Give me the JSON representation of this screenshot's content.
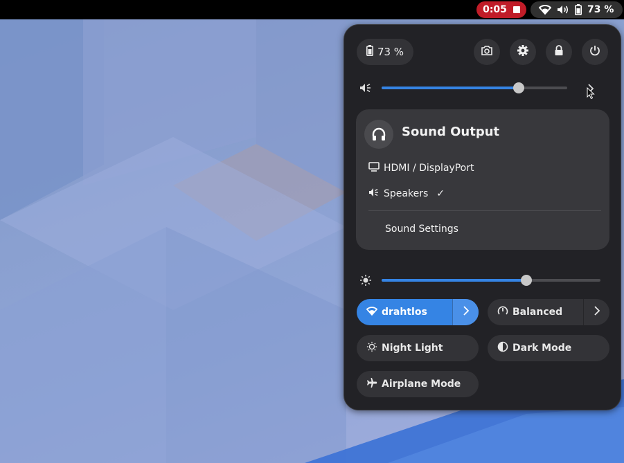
{
  "topbar": {
    "recording_time": "0:05",
    "battery_percent": "73 %",
    "icons": [
      "stop-icon",
      "wifi-icon",
      "volume-icon",
      "battery-icon"
    ]
  },
  "quick_settings": {
    "battery_label": "73 %",
    "system_buttons": [
      {
        "name": "screenshot-icon"
      },
      {
        "name": "gear-icon"
      },
      {
        "name": "lock-icon"
      },
      {
        "name": "power-icon"
      }
    ],
    "volume": {
      "icon": "speaker-icon",
      "level": 0.74
    },
    "sound_output": {
      "title": "Sound Output",
      "devices": [
        {
          "label": "HDMI / DisplayPort",
          "icon": "monitor-icon",
          "selected": false
        },
        {
          "label": "Speakers",
          "icon": "speaker-icon",
          "selected": true,
          "check": "✓"
        }
      ],
      "settings_label": "Sound Settings"
    },
    "brightness": {
      "icon": "brightness-icon",
      "level": 0.66
    },
    "toggles": {
      "wifi": {
        "label": "drahtlos",
        "active": true
      },
      "power_mode": {
        "label": "Balanced",
        "active": false
      },
      "night_light": {
        "label": "Night Light",
        "active": false
      },
      "dark_mode": {
        "label": "Dark Mode",
        "active": false
      },
      "airplane": {
        "label": "Airplane Mode",
        "active": false
      }
    }
  },
  "colors": {
    "accent": "#3584e4",
    "record": "#c01c28",
    "panel": "#222226"
  }
}
